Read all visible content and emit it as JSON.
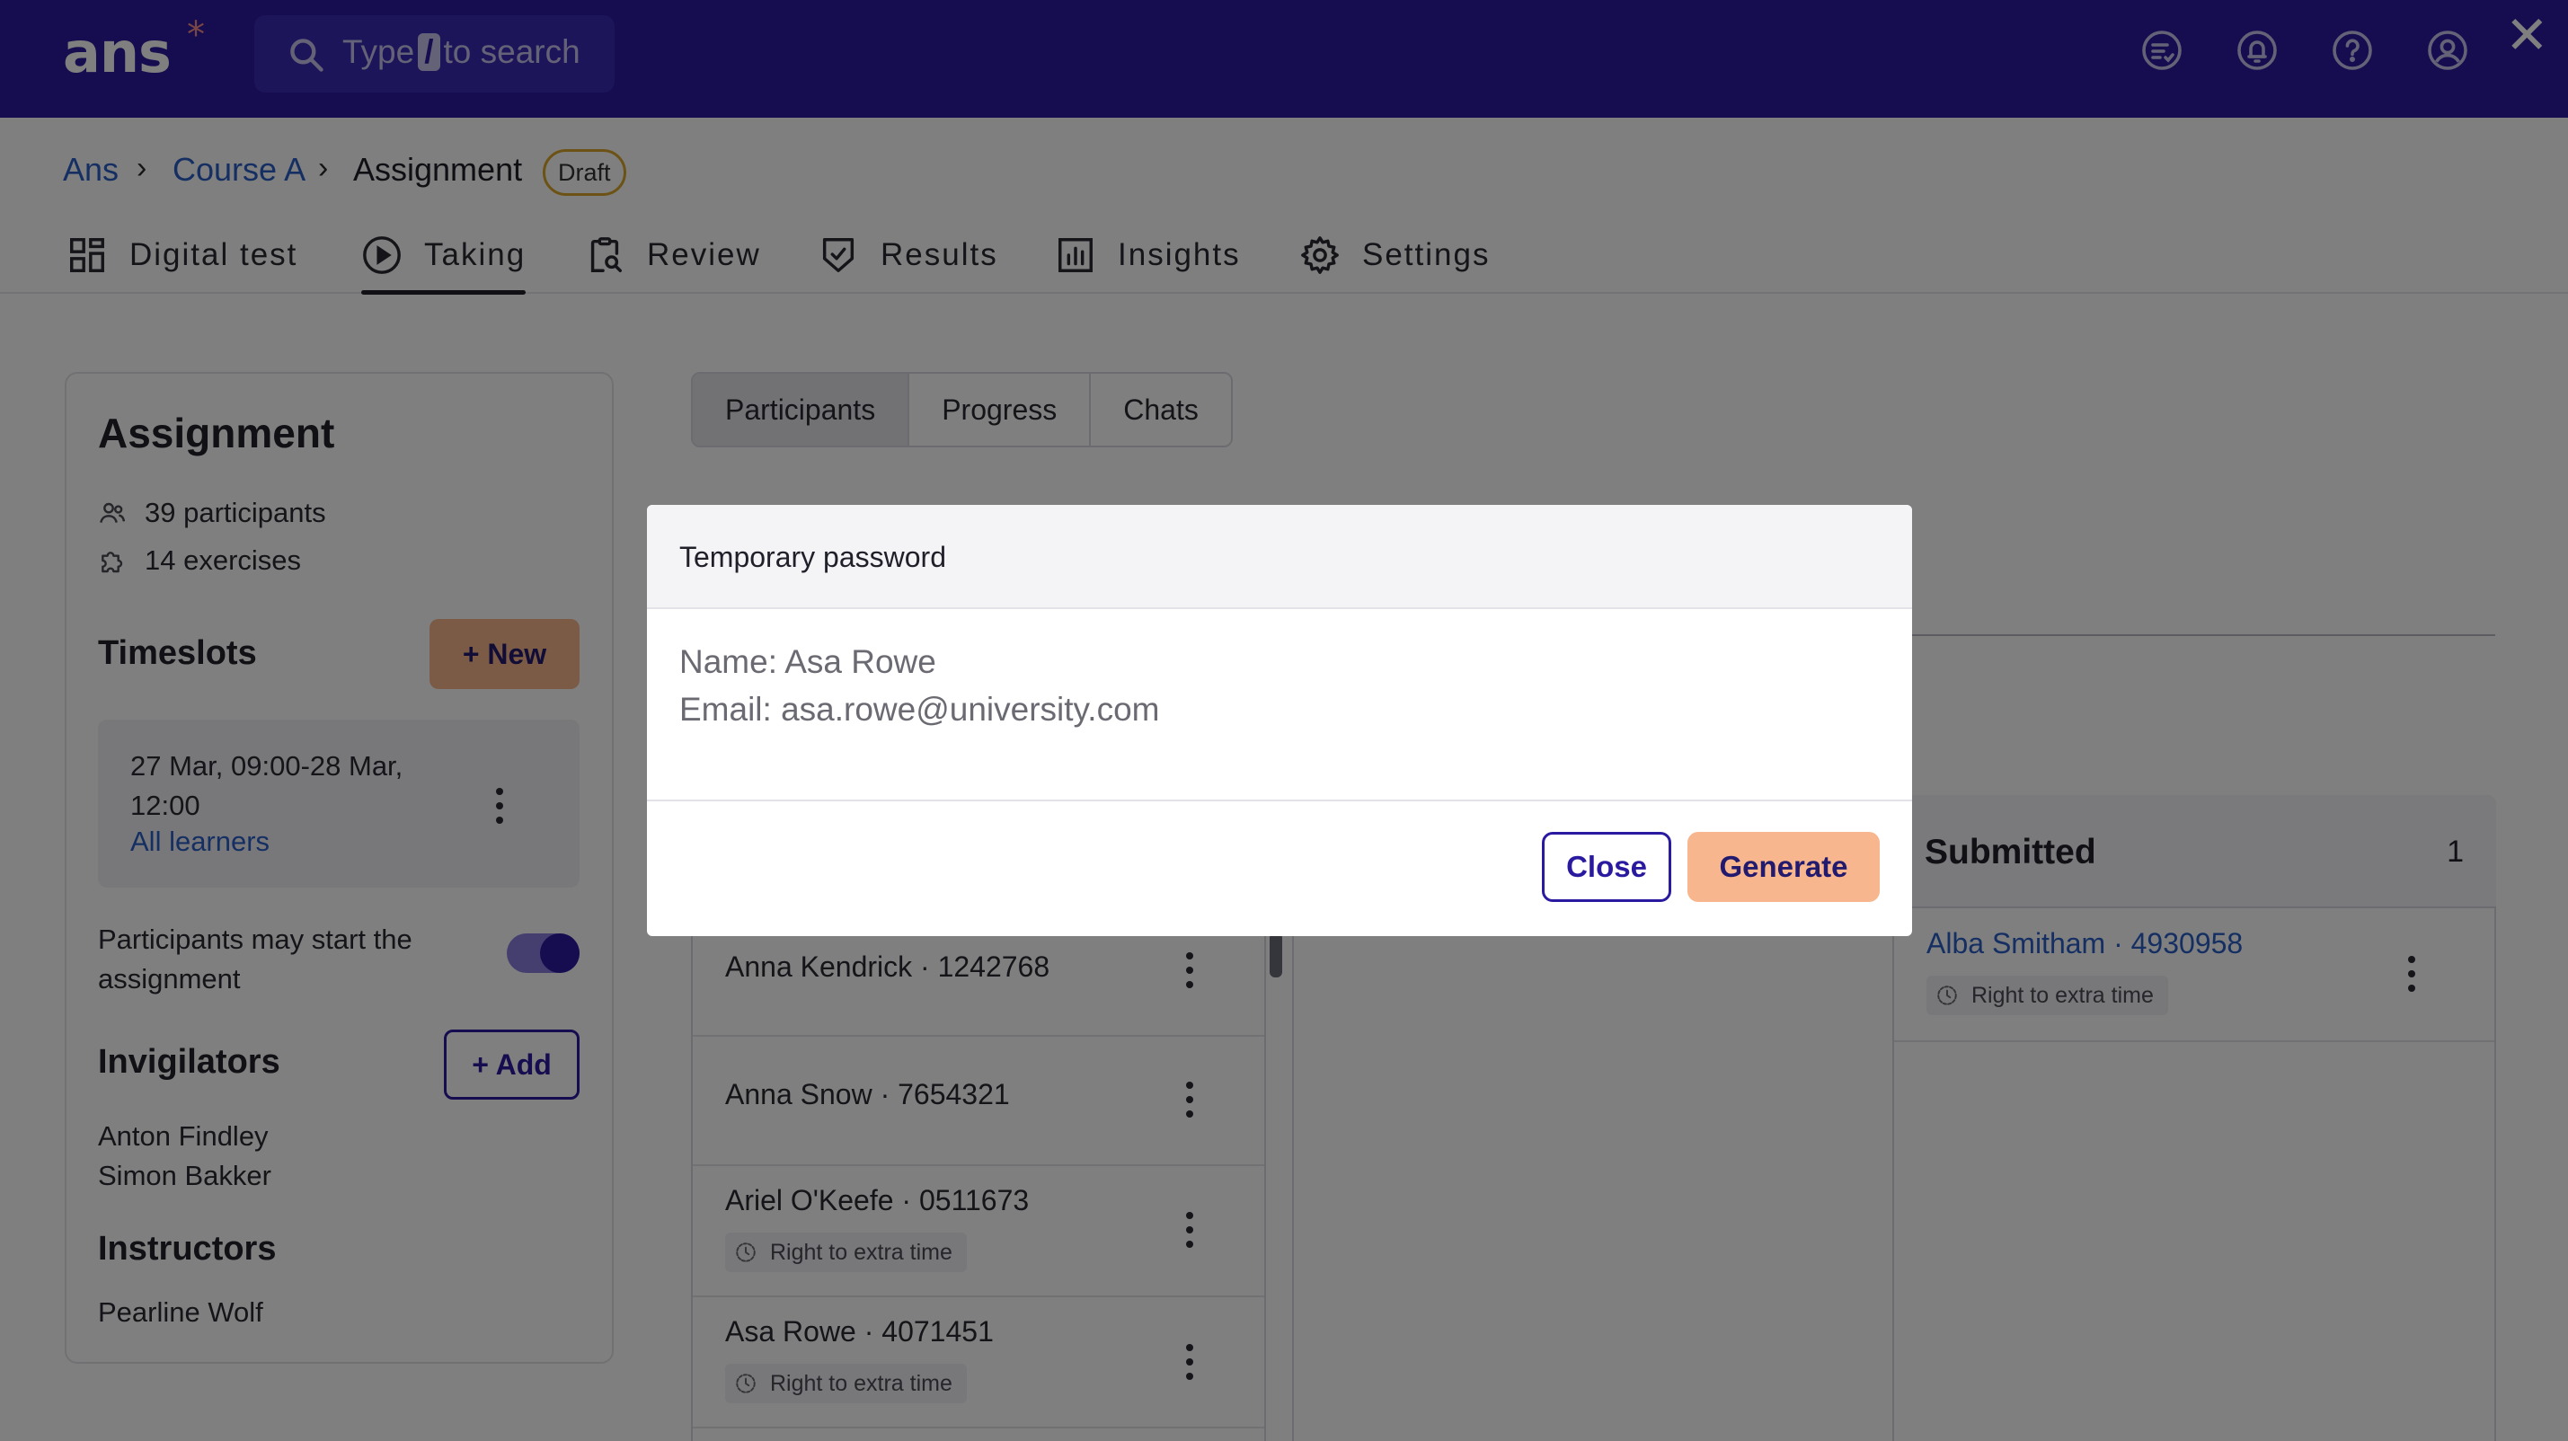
{
  "app": {
    "logo": "ans",
    "logo_mark": "*"
  },
  "search": {
    "prefix": "Type",
    "key": "/",
    "suffix": "to search"
  },
  "topbar_icons": [
    "chat-list-icon",
    "bell-icon",
    "help-icon",
    "user-icon"
  ],
  "breadcrumb": {
    "root": "Ans",
    "course": "Course A",
    "current": "Assignment",
    "status": "Draft"
  },
  "nav_tabs": [
    {
      "label": "Digital test",
      "icon": "grid-icon"
    },
    {
      "label": "Taking",
      "icon": "play-icon",
      "active": true
    },
    {
      "label": "Review",
      "icon": "clipboard-search-icon"
    },
    {
      "label": "Results",
      "icon": "shield-check-icon"
    },
    {
      "label": "Insights",
      "icon": "bar-chart-icon"
    },
    {
      "label": "Settings",
      "icon": "gear-icon"
    }
  ],
  "sidebar": {
    "title": "Assignment",
    "participants": "39 participants",
    "exercises": "14 exercises",
    "timeslots_heading": "Timeslots",
    "new_button": "+ New",
    "timeslot": {
      "range": "27 Mar, 09:00-28 Mar, 12:00",
      "audience": "All learners"
    },
    "start_toggle_label": "Participants may start the assignment",
    "start_toggle_on": true,
    "invigilators_heading": "Invigilators",
    "add_button": "+ Add",
    "invigilators": [
      "Anton Findley",
      "Simon Bakker"
    ],
    "instructors_heading": "Instructors",
    "instructors": [
      "Pearline Wolf"
    ]
  },
  "sub_tabs": [
    {
      "label": "Participants",
      "active": true
    },
    {
      "label": "Progress"
    },
    {
      "label": "Chats"
    }
  ],
  "not_started_rows": [
    {
      "name": "Anna Kendrick · 1242768"
    },
    {
      "name": "Anna Snow · 7654321"
    },
    {
      "name": "Ariel O'Keefe · 0511673",
      "badge": "Right to extra time"
    },
    {
      "name": "Asa Rowe · 4071451",
      "badge": "Right to extra time"
    }
  ],
  "submitted": {
    "title": "Submitted",
    "count": "1",
    "rows": [
      {
        "name": "Alba Smitham · 4930958",
        "badge": "Right to extra time"
      }
    ]
  },
  "modal": {
    "title": "Temporary password",
    "name_line": "Name: Asa Rowe",
    "email_line": "Email: asa.rowe@university.com",
    "close_button": "Close",
    "generate_button": "Generate"
  },
  "window_close": "✕",
  "colors": {
    "brand": "#2a1aa0",
    "accent": "#f7b68d",
    "link": "#2b5fc7",
    "draft_badge": "#d9a52b"
  }
}
